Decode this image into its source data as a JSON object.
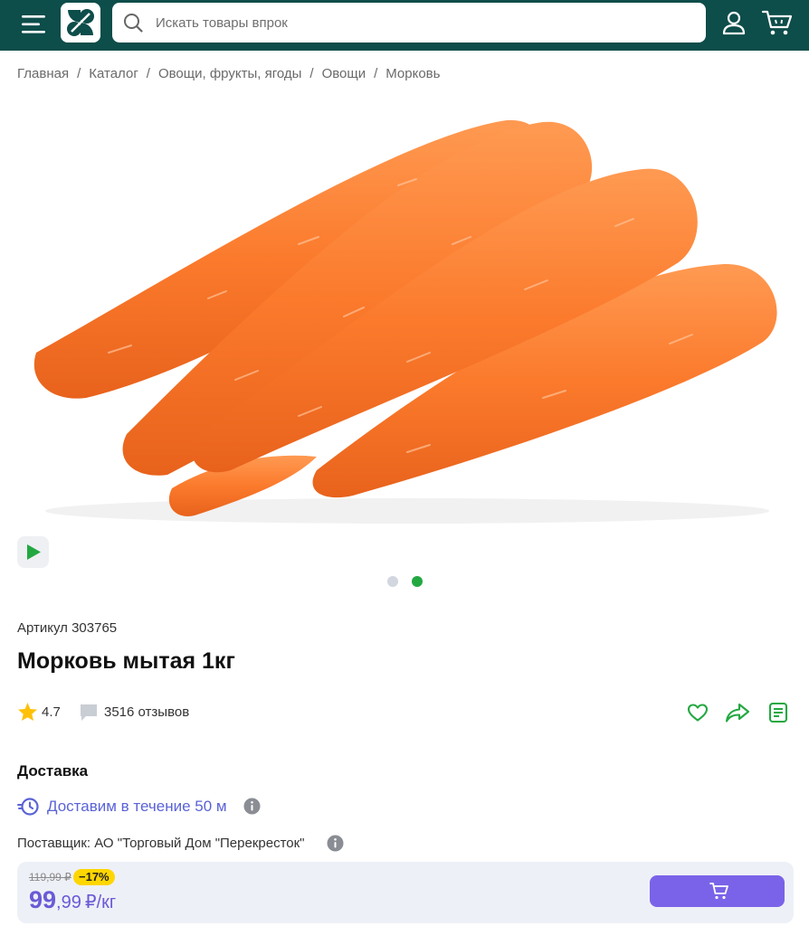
{
  "header": {
    "search_placeholder": "Искать товары впрок",
    "menu_icon": "menu-icon",
    "logo_icon": "perekrestok-logo",
    "search_icon": "search-icon",
    "user_icon": "user-icon",
    "cart_icon": "cart-icon"
  },
  "breadcrumbs": [
    "Главная",
    "Каталог",
    "Овощи, фрукты, ягоды",
    "Овощи",
    "Морковь"
  ],
  "breadcrumb_separator": "/",
  "product": {
    "sku_label": "Артикул 303765",
    "title": "Морковь мытая 1кг",
    "rating": "4.7",
    "reviews": "3516 отзывов",
    "image_icon": "carrots-image",
    "gallery_active_index": 1,
    "gallery_count": 2
  },
  "delivery": {
    "title": "Доставка",
    "text": "Доставим в течение 50 м",
    "supplier": "Поставщик: АО \"Торговый Дом \"Перекресток\""
  },
  "price": {
    "old": "119,99 ₽",
    "discount": "−17%",
    "rub": "99",
    "kop": ",99",
    "unit": "₽/кг"
  },
  "colors": {
    "header_bg": "#0d4d4a",
    "accent_green": "#23a841",
    "accent_purple": "#7a63e8",
    "delivery_blue": "#5a63d6",
    "discount_yellow": "#ffd600"
  }
}
